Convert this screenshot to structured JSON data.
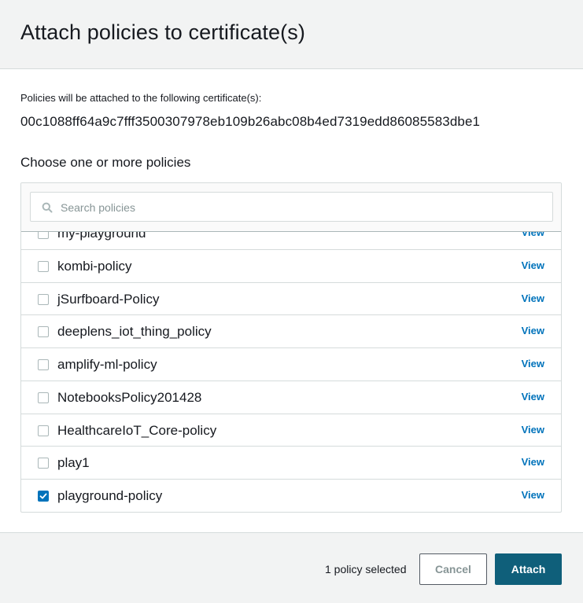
{
  "dialog": {
    "title": "Attach policies to certificate(s)",
    "intro": "Policies will be attached to the following certificate(s):",
    "certificate_id": "00c1088ff64a9c7fff3500307978eb109b26abc08b4ed7319edd86085583dbe1",
    "choose_label": "Choose one or more policies"
  },
  "search": {
    "placeholder": "Search policies",
    "value": ""
  },
  "policies": [
    {
      "name": "my-playground",
      "view_label": "View",
      "checked": false
    },
    {
      "name": "kombi-policy",
      "view_label": "View",
      "checked": false
    },
    {
      "name": "jSurfboard-Policy",
      "view_label": "View",
      "checked": false
    },
    {
      "name": "deeplens_iot_thing_policy",
      "view_label": "View",
      "checked": false
    },
    {
      "name": "amplify-ml-policy",
      "view_label": "View",
      "checked": false
    },
    {
      "name": "NotebooksPolicy201428",
      "view_label": "View",
      "checked": false
    },
    {
      "name": "HealthcareIoT_Core-policy",
      "view_label": "View",
      "checked": false
    },
    {
      "name": "play1",
      "view_label": "View",
      "checked": false
    },
    {
      "name": "playground-policy",
      "view_label": "View",
      "checked": true
    }
  ],
  "footer": {
    "selected_count": "1 policy selected",
    "cancel_label": "Cancel",
    "attach_label": "Attach"
  },
  "colors": {
    "accent": "#0073bb",
    "primary_button": "#0f5f7a",
    "header_bg": "#f2f3f3"
  }
}
